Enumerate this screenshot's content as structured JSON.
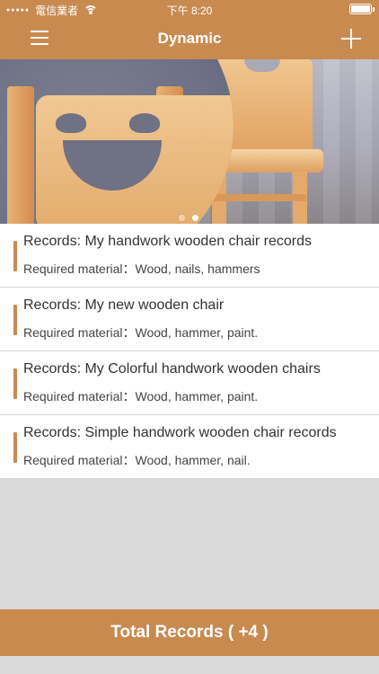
{
  "status_bar": {
    "carrier": "電信業者",
    "time": "下午 8:20"
  },
  "navbar": {
    "title": "Dynamic",
    "menu_icon": "hamburger-menu-icon",
    "add_icon": "plus-icon"
  },
  "banner": {
    "pages": 2,
    "current_page": 2
  },
  "records": [
    {
      "title": "Records: My handwork wooden chair records",
      "material": "Required material：Wood, nails, hammers"
    },
    {
      "title": "Records: My new wooden chair",
      "material": "Required material：Wood, hammer, paint."
    },
    {
      "title": "Records: My Colorful handwork wooden chairs",
      "material": "Required material：Wood, hammer, paint."
    },
    {
      "title": "Records: Simple handwork wooden chair records",
      "material": "Required material：Wood, hammer, nail."
    }
  ],
  "footer": {
    "total_label": "Total Records ( +4 )"
  },
  "colors": {
    "accent": "#c98a4f",
    "background": "#dadada"
  }
}
